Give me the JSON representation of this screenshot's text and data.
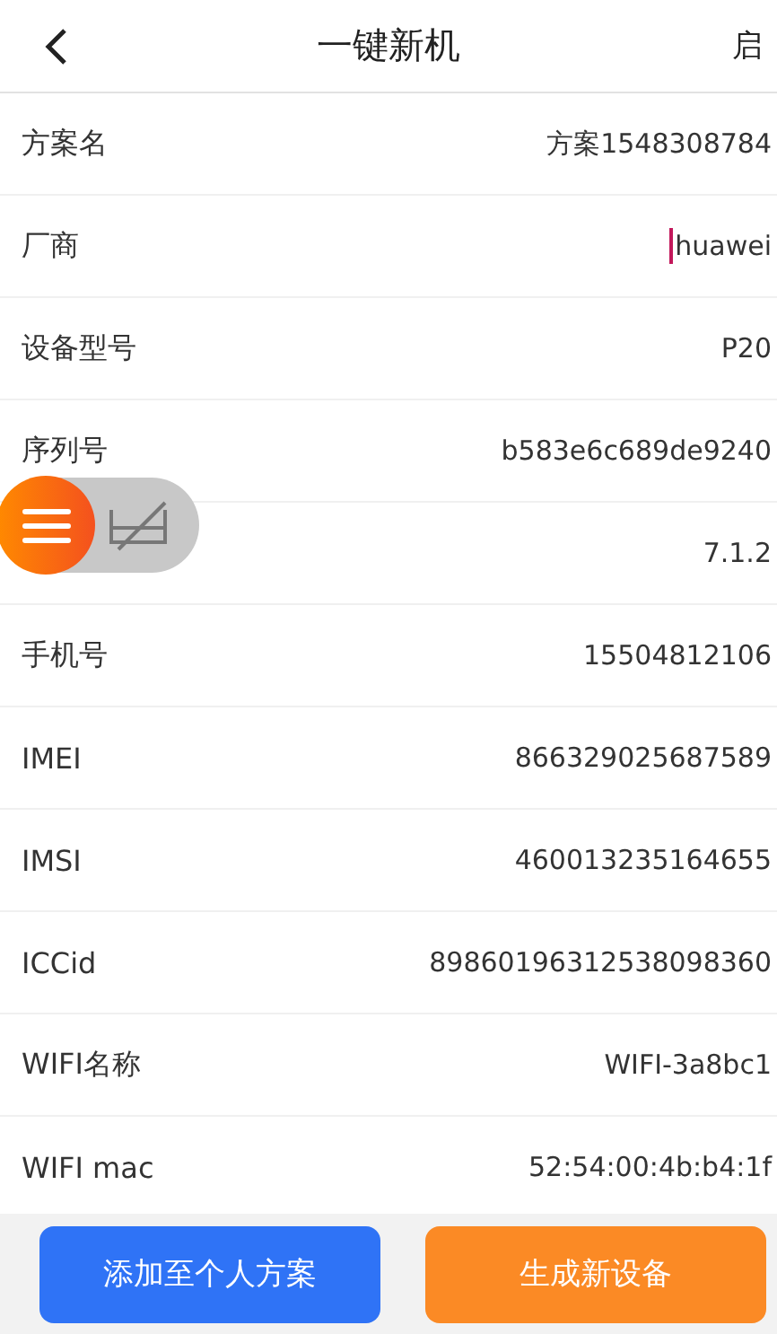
{
  "header": {
    "title": "一键新机",
    "action": "启"
  },
  "fields": [
    {
      "label": "方案名",
      "value": "方案1548308784"
    },
    {
      "label": "厂商",
      "value": "huawei",
      "focused": true
    },
    {
      "label": "设备型号",
      "value": "P20"
    },
    {
      "label": "序列号",
      "value": "b583e6c689de9240"
    },
    {
      "value": "7.1.2"
    },
    {
      "label": "手机号",
      "value": "15504812106"
    },
    {
      "label": "IMEI",
      "value": "866329025687589"
    },
    {
      "label": "IMSI",
      "value": "460013235164655"
    },
    {
      "label": "ICCid",
      "value": "89860196312538098360"
    },
    {
      "label": "WIFI名称",
      "value": "WIFI-3a8bc1"
    },
    {
      "label": "WIFI mac",
      "value": "52:54:00:4b:b4:1f"
    }
  ],
  "buttons": [
    {
      "label": "添加至个人方案",
      "kind": "primary"
    },
    {
      "label": "生成新设备",
      "kind": "accent"
    }
  ]
}
